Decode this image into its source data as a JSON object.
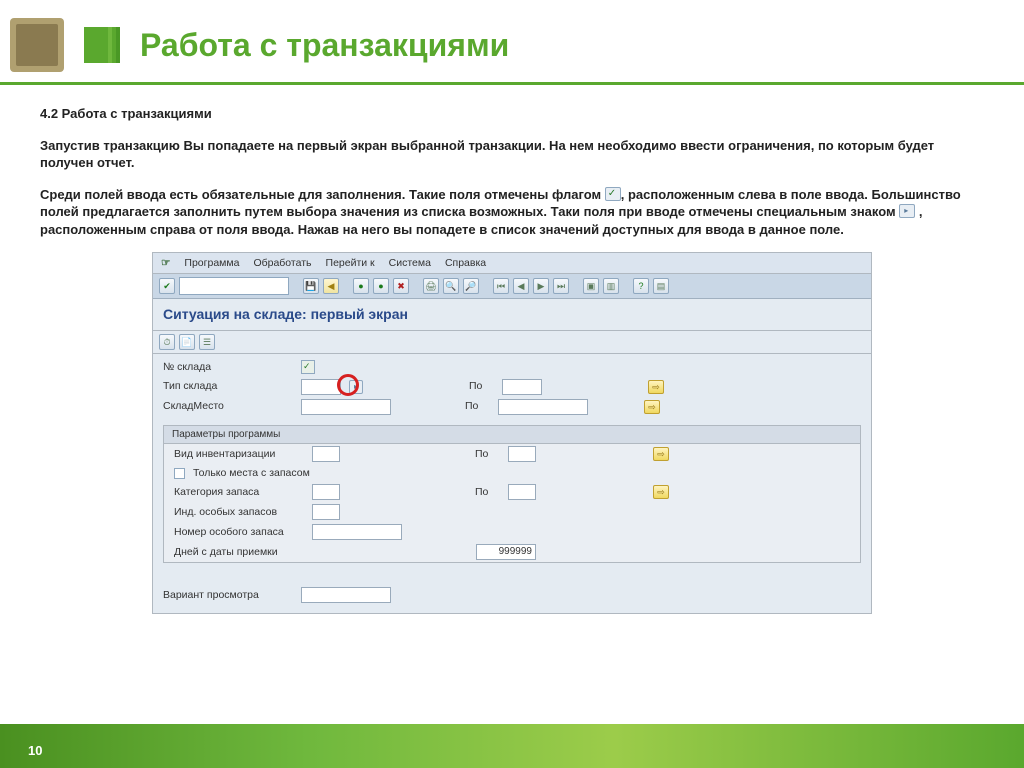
{
  "slide": {
    "title": "Работа с транзакциями",
    "section_heading": "4.2 Работа с транзакциями",
    "para1": "Запустив транзакцию Вы попадаете на первый экран выбранной транзакции.  На нем необходимо ввести ограничения, по которым будет получен отчет.",
    "para2a": "Среди полей ввода есть обязательные для заполнения. Такие поля отмечены флагом ",
    "para2b": ", расположенным слева в поле ввода. Большинство полей предлагается заполнить путем выбора  значения из списка возможных. Таки поля при вводе отмечены специальным знаком ",
    "para2c": " , расположенным справа от поля ввода. Нажав на него вы попадете в список значений доступных для ввода в данное поле.",
    "page_number": "10"
  },
  "sap": {
    "menu": {
      "icon": "☞",
      "items": [
        "Программа",
        "Обработать",
        "Перейти к",
        "Система",
        "Справка"
      ]
    },
    "screen_title": "Ситуация на складе: первый экран",
    "field_po": "По",
    "fields": {
      "warehouse_no": "№ склада",
      "warehouse_type": "Тип склада",
      "warehouse_place": "СкладМесто"
    },
    "group": {
      "title": "Параметры программы",
      "inventory_type": "Вид инвентаризации",
      "only_stock_places": "Только места с запасом",
      "stock_category": "Категория запаса",
      "special_stock_ind": "Инд. особых запасов",
      "special_stock_no": "Номер особого запаса",
      "days_from_receipt": "Дней с даты приемки",
      "days_value": "999999"
    },
    "display_variant": "Вариант просмотра"
  }
}
